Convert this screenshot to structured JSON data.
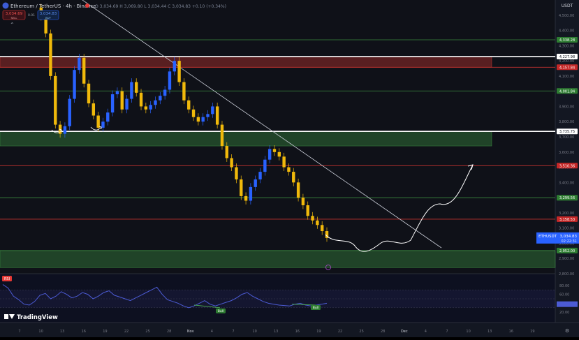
{
  "header": {
    "symbol_full": "Ethereum / TetherUS · 4h · Binance",
    "sell_price": "3,034.69",
    "sell_label": "SELL",
    "spread": "0.01",
    "buy_price": "3,034.83",
    "buy_label": "BUY",
    "ohlc": "O 3,034.69  H 3,069.80  L 3,034.44  C 3,034.83  +0.10 (+0.34%)",
    "currency": "USDT"
  },
  "chart_data": {
    "type": "line",
    "title": "Ethereum / TetherUS · 4h · Binance",
    "xlabel": "",
    "ylabel": "",
    "ylim": [
      2800,
      4600
    ],
    "grid": false,
    "price_ticks": [
      "4,500.00",
      "4,400.00",
      "4,300.00",
      "4,200.00",
      "4,100.00",
      "4,000.00",
      "3,900.00",
      "3,800.00",
      "3,700.00",
      "3,600.00",
      "3,500.00",
      "3,400.00",
      "3,300.00",
      "3,200.00",
      "3,100.00",
      "3,000.00",
      "2,900.00",
      "2,800.00"
    ],
    "date_ticks": [
      "7",
      "10",
      "13",
      "16",
      "19",
      "22",
      "25",
      "28",
      "Nov",
      "4",
      "7",
      "10",
      "13",
      "16",
      "19",
      "22",
      "25",
      "28",
      "Dec",
      "4",
      "7",
      "10",
      "13",
      "16",
      "19"
    ],
    "levels": [
      {
        "label": "4,338.28",
        "value": 4338.28,
        "color": "#43a047",
        "badge_bg": "#2e7d32"
      },
      {
        "label": "4,227.98",
        "value": 4227.98,
        "color": "#ffffff",
        "badge_bg": "#ffffff"
      },
      {
        "label": "4,157.84",
        "value": 4157.84,
        "color": "#e53935",
        "badge_bg": "#c62828"
      },
      {
        "label": "4,001.84",
        "value": 4001.84,
        "color": "#43a047",
        "badge_bg": "#2e7d32"
      },
      {
        "label": "3,735.75",
        "value": 3735.75,
        "color": "#ffffff",
        "badge_bg": "#ffffff"
      },
      {
        "label": "3,510.36",
        "value": 3510.36,
        "color": "#e53935",
        "badge_bg": "#c62828"
      },
      {
        "label": "3,299.56",
        "value": 3299.56,
        "color": "#43a047",
        "badge_bg": "#2e7d32"
      },
      {
        "label": "3,158.53",
        "value": 3158.53,
        "color": "#e53935",
        "badge_bg": "#c62828"
      },
      {
        "label": "2,952.00",
        "value": 2952.0,
        "color": "#43a047",
        "badge_bg": "#2e7d32"
      }
    ],
    "last_price": {
      "symbol": "ETHUSDT",
      "price": "3,034.83",
      "countdown": "02:22:31",
      "value": 3034.83
    },
    "zones": [
      {
        "from": 4157.84,
        "to": 4227.98,
        "color": "#e53935"
      },
      {
        "from": 3640,
        "to": 3735.75,
        "color": "#43a047"
      },
      {
        "from": 2840,
        "to": 2952.0,
        "color": "#43a047"
      }
    ],
    "series": [
      {
        "values": [
          4550,
          4490,
          4380,
          4100,
          3780,
          3720,
          3770,
          3950,
          4140,
          4220,
          4050,
          3920,
          3840,
          3760,
          3800,
          3860,
          3980,
          4000,
          3880,
          3950,
          4060,
          3990,
          3900,
          3880,
          3910,
          3940,
          3970,
          4010,
          4130,
          4200,
          4060,
          3940,
          3880,
          3830,
          3800,
          3830,
          3850,
          3900,
          3780,
          3640,
          3560,
          3500,
          3420,
          3310,
          3280,
          3370,
          3420,
          3470,
          3550,
          3620,
          3600,
          3570,
          3500,
          3470,
          3400,
          3300,
          3250,
          3180,
          3150,
          3120,
          3080,
          3034.83
        ]
      }
    ],
    "rsi": {
      "label": "RSI",
      "ylim": [
        0,
        100
      ],
      "ticks": [
        "80.00",
        "60.00",
        "40.00",
        "20.00"
      ],
      "values": [
        82,
        74,
        56,
        48,
        38,
        36,
        44,
        58,
        62,
        50,
        56,
        66,
        60,
        52,
        56,
        64,
        60,
        50,
        56,
        64,
        68,
        58,
        54,
        50,
        46,
        52,
        58,
        64,
        70,
        76,
        60,
        48,
        44,
        40,
        34,
        30,
        34,
        40,
        46,
        38,
        34,
        38,
        42,
        46,
        52,
        60,
        64,
        56,
        50,
        44,
        40,
        38,
        36,
        35,
        34,
        38,
        40,
        36,
        34,
        36,
        38,
        40
      ],
      "divergence_labels": [
        "Bull",
        "Bull"
      ]
    }
  },
  "watermark": "TradingView"
}
